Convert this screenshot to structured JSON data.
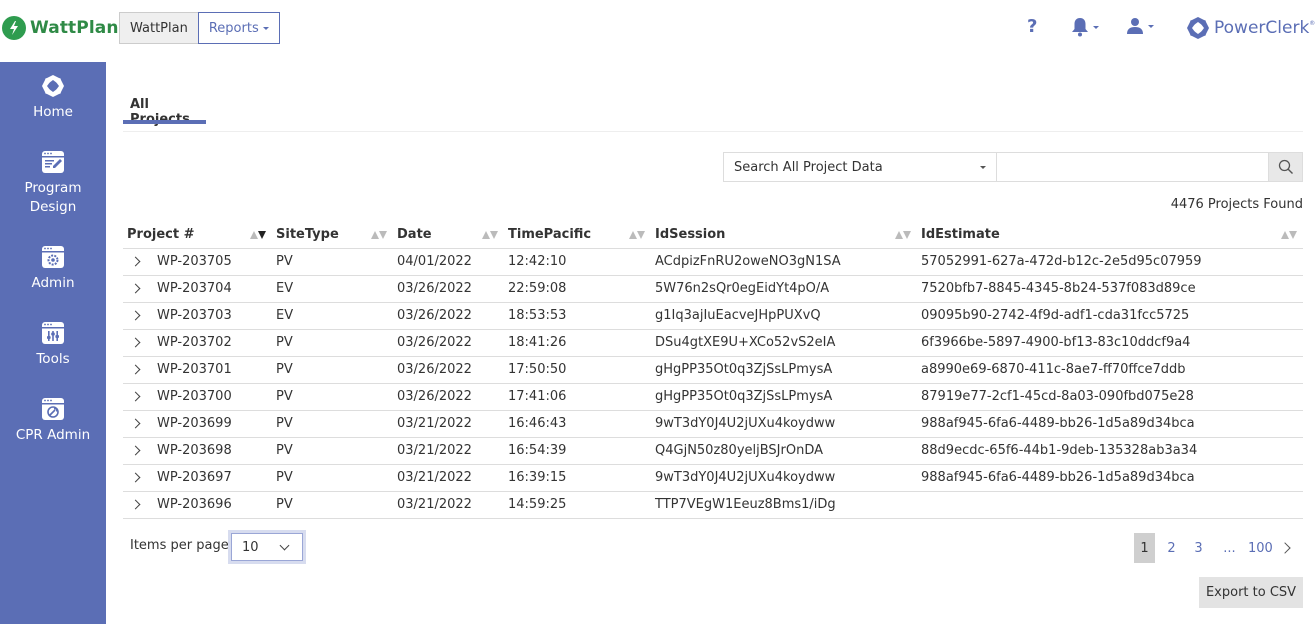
{
  "header": {
    "logo_text": "WattPlan",
    "logo_mark": "®",
    "nav": [
      {
        "label": "WattPlan"
      },
      {
        "label": "Reports"
      }
    ],
    "help_label": "?",
    "brand_right": "PowerClerk",
    "brand_right_mark": "®"
  },
  "colors": {
    "accent": "#5b6eb5",
    "brand_green": "#2f9c4f"
  },
  "sidebar": {
    "items": [
      {
        "label": "Home",
        "icon": "powerclerk-logo-icon"
      },
      {
        "label": "Program Design",
        "icon": "design-icon"
      },
      {
        "label": "Admin",
        "icon": "gear-window-icon"
      },
      {
        "label": "Tools",
        "icon": "sliders-window-icon"
      },
      {
        "label": "CPR Admin",
        "icon": "wrench-window-icon"
      }
    ]
  },
  "main": {
    "tab_label": "All Projects",
    "search": {
      "scope_selected": "Search All Project Data",
      "query": "",
      "placeholder": ""
    },
    "results_count": "4476 Projects Found",
    "columns": [
      "Project #",
      "SiteType",
      "Date",
      "TimePacific",
      "IdSession",
      "IdEstimate"
    ],
    "rows": [
      {
        "project": "WP-203705",
        "site": "PV",
        "date": "04/01/2022",
        "time": "12:42:10",
        "session": "ACdpizFnRU2oweNO3gN1SA",
        "estimate": "57052991-627a-472d-b12c-2e5d95c07959"
      },
      {
        "project": "WP-203704",
        "site": "EV",
        "date": "03/26/2022",
        "time": "22:59:08",
        "session": "5W76n2sQr0egEidYt4pO/A",
        "estimate": "7520bfb7-8845-4345-8b24-537f083d89ce"
      },
      {
        "project": "WP-203703",
        "site": "EV",
        "date": "03/26/2022",
        "time": "18:53:53",
        "session": "g1Iq3ajIuEacveJHpPUXvQ",
        "estimate": "09095b90-2742-4f9d-adf1-cda31fcc5725"
      },
      {
        "project": "WP-203702",
        "site": "PV",
        "date": "03/26/2022",
        "time": "18:41:26",
        "session": "DSu4gtXE9U+XCo52vS2eIA",
        "estimate": "6f3966be-5897-4900-bf13-83c10ddcf9a4"
      },
      {
        "project": "WP-203701",
        "site": "PV",
        "date": "03/26/2022",
        "time": "17:50:50",
        "session": "gHgPP35Ot0q3ZjSsLPmysA",
        "estimate": "a8990e69-6870-411c-8ae7-ff70ffce7ddb"
      },
      {
        "project": "WP-203700",
        "site": "PV",
        "date": "03/26/2022",
        "time": "17:41:06",
        "session": "gHgPP35Ot0q3ZjSsLPmysA",
        "estimate": "87919e77-2cf1-45cd-8a03-090fbd075e28"
      },
      {
        "project": "WP-203699",
        "site": "PV",
        "date": "03/21/2022",
        "time": "16:46:43",
        "session": "9wT3dY0J4U2jUXu4koydww",
        "estimate": "988af945-6fa6-4489-bb26-1d5a89d34bca"
      },
      {
        "project": "WP-203698",
        "site": "PV",
        "date": "03/21/2022",
        "time": "16:54:39",
        "session": "Q4GjN50z80yeljBSJrOnDA",
        "estimate": "88d9ecdc-65f6-44b1-9deb-135328ab3a34"
      },
      {
        "project": "WP-203697",
        "site": "PV",
        "date": "03/21/2022",
        "time": "16:39:15",
        "session": "9wT3dY0J4U2jUXu4koydww",
        "estimate": "988af945-6fa6-4489-bb26-1d5a89d34bca"
      },
      {
        "project": "WP-203696",
        "site": "PV",
        "date": "03/21/2022",
        "time": "14:59:25",
        "session": "TTP7VEgW1Eeuz8Bms1/iDg",
        "estimate": ""
      }
    ],
    "items_per_page_label": "Items per page:",
    "items_per_page_value": "10",
    "pagination": {
      "pages": [
        "1",
        "2",
        "3",
        "...",
        "100"
      ],
      "current": "1"
    },
    "export_label": "Export to CSV"
  }
}
